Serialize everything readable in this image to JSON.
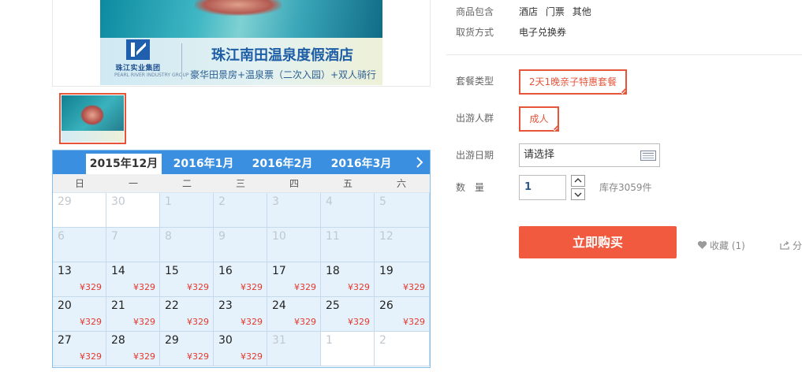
{
  "banner": {
    "hotel_name": "珠江南田温泉度假酒店",
    "package_desc": "豪华田景房+温泉票（二次入园）+双人骑行",
    "group_name": "珠江实业集团",
    "group_sub": "PEARL RIVER INDUSTRY GROUP"
  },
  "calendar": {
    "months": [
      {
        "label": "2015年12月",
        "active": true
      },
      {
        "label": "2016年1月",
        "active": false
      },
      {
        "label": "2016年2月",
        "active": false
      },
      {
        "label": "2016年3月",
        "active": false
      }
    ],
    "weekdays": [
      "日",
      "一",
      "二",
      "三",
      "四",
      "五",
      "六"
    ],
    "weeks": [
      [
        {
          "day": "29",
          "price": "",
          "state": "out-white"
        },
        {
          "day": "30",
          "price": "",
          "state": "out-white"
        },
        {
          "day": "1",
          "price": "",
          "state": "disabled"
        },
        {
          "day": "2",
          "price": "",
          "state": "disabled"
        },
        {
          "day": "3",
          "price": "",
          "state": "disabled"
        },
        {
          "day": "4",
          "price": "",
          "state": "disabled"
        },
        {
          "day": "5",
          "price": "",
          "state": "disabled"
        }
      ],
      [
        {
          "day": "6",
          "price": "",
          "state": "disabled"
        },
        {
          "day": "7",
          "price": "",
          "state": "disabled"
        },
        {
          "day": "8",
          "price": "",
          "state": "disabled"
        },
        {
          "day": "9",
          "price": "",
          "state": "disabled"
        },
        {
          "day": "10",
          "price": "",
          "state": "disabled"
        },
        {
          "day": "11",
          "price": "",
          "state": "disabled"
        },
        {
          "day": "12",
          "price": "",
          "state": "disabled"
        }
      ],
      [
        {
          "day": "13",
          "price": "¥329",
          "state": "available"
        },
        {
          "day": "14",
          "price": "¥329",
          "state": "available"
        },
        {
          "day": "15",
          "price": "¥329",
          "state": "available"
        },
        {
          "day": "16",
          "price": "¥329",
          "state": "available"
        },
        {
          "day": "17",
          "price": "¥329",
          "state": "available"
        },
        {
          "day": "18",
          "price": "¥329",
          "state": "available"
        },
        {
          "day": "19",
          "price": "¥329",
          "state": "available"
        }
      ],
      [
        {
          "day": "20",
          "price": "¥329",
          "state": "available"
        },
        {
          "day": "21",
          "price": "¥329",
          "state": "available"
        },
        {
          "day": "22",
          "price": "¥329",
          "state": "available"
        },
        {
          "day": "23",
          "price": "¥329",
          "state": "available"
        },
        {
          "day": "24",
          "price": "¥329",
          "state": "available"
        },
        {
          "day": "25",
          "price": "¥329",
          "state": "available"
        },
        {
          "day": "26",
          "price": "¥329",
          "state": "available"
        }
      ],
      [
        {
          "day": "27",
          "price": "¥329",
          "state": "available"
        },
        {
          "day": "28",
          "price": "¥329",
          "state": "available"
        },
        {
          "day": "29",
          "price": "¥329",
          "state": "available"
        },
        {
          "day": "30",
          "price": "¥329",
          "state": "available"
        },
        {
          "day": "31",
          "price": "",
          "state": "disabled"
        },
        {
          "day": "1",
          "price": "",
          "state": "out-white"
        },
        {
          "day": "2",
          "price": "",
          "state": "out-white"
        }
      ]
    ]
  },
  "product": {
    "includes_label": "商品包含",
    "includes": [
      "酒店",
      "门票",
      "其他"
    ],
    "pickup_label": "取货方式",
    "pickup_value": "电子兑换券",
    "package_label": "套餐类型",
    "package_option": "2天1晚亲子特惠套餐",
    "traveler_label": "出游人群",
    "traveler_option": "成人",
    "date_label": "出游日期",
    "date_placeholder": "请选择",
    "qty_label": "数　量",
    "qty_value": "1",
    "stock_text": "库存3059件",
    "buy_label": "立即购买",
    "fav_label": "收藏 (1)",
    "share_label": "分"
  },
  "colors": {
    "accent": "#f15a3f",
    "calendar_header": "#3a8fe0",
    "price": "#e4392f",
    "cell_available": "#e5f2fb"
  }
}
